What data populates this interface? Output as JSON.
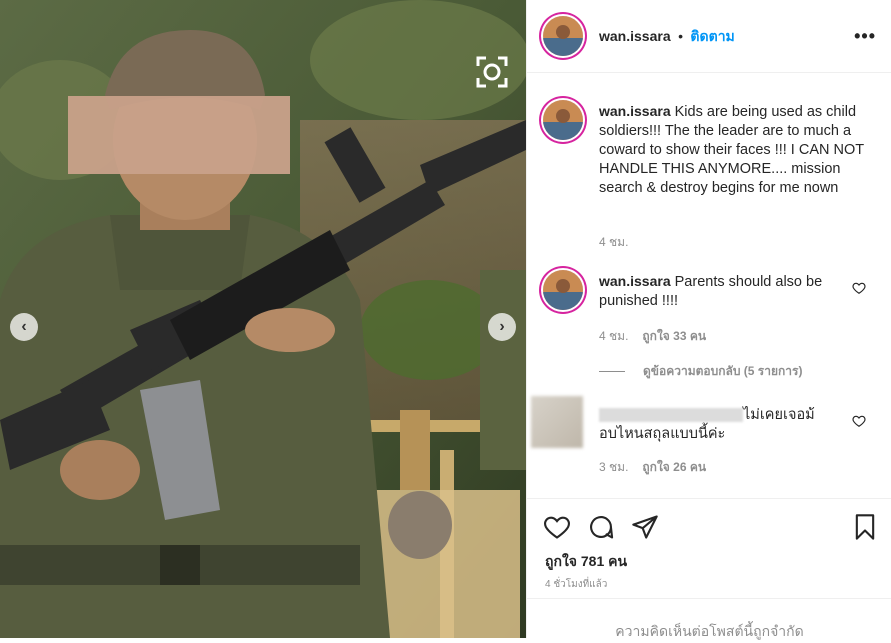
{
  "header": {
    "username": "wan.issara",
    "separator": "•",
    "follow_label": "ติดตาม",
    "more_label": "•••"
  },
  "caption": {
    "username": "wan.issara",
    "text": "Kids are being used as child soldiers!!! The the leader are to much a coward to show their faces !!! I CAN NOT HANDLE THIS ANYMORE.... mission search & destroy begins for me nown",
    "time": "4 ชม."
  },
  "comments": [
    {
      "username": "wan.issara",
      "text": "Parents should also be punished !!!!",
      "time": "4 ชม.",
      "likes": "ถูกใจ 33 คน",
      "view_replies": "ดูข้อความตอบกลับ (5 รายการ)"
    },
    {
      "text": "ไม่เคยเจอม้อบไหนสถุลแบบนี้ค่ะ",
      "time": "3 ชม.",
      "likes": "ถูกใจ 26 คน"
    }
  ],
  "post": {
    "likes": "ถูกใจ 781 คน",
    "time_ago": "4 ชั่วโมงที่แล้ว",
    "comments_limited": "ความคิดเห็นต่อโพสต์นี้ถูกจำกัด"
  },
  "nav": {
    "prev": "‹",
    "next": "›"
  },
  "colors": {
    "accent": "#0095f6",
    "text": "#262626",
    "muted": "#8e8e8e",
    "border": "#efefef"
  },
  "icons": [
    "scan-icon",
    "chevron-left-icon",
    "chevron-right-icon",
    "heart-icon",
    "comment-icon",
    "share-icon",
    "bookmark-icon",
    "more-icon"
  ]
}
